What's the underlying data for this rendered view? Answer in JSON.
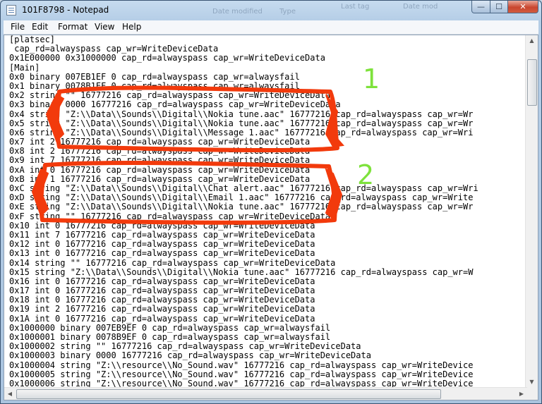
{
  "window": {
    "title": "101F8798 - Notepad"
  },
  "background_headers": [
    "Date modified",
    "Type",
    "Last tag",
    "Date mod"
  ],
  "menu": [
    "File",
    "Edit",
    "Format",
    "View",
    "Help"
  ],
  "caption_buttons": {
    "minimize": "—",
    "maximize": "☐",
    "close": "✕"
  },
  "lines": [
    "[platsec]",
    " cap_rd=alwayspass cap_wr=WriteDeviceData",
    "0x1E000000 0x31000000 cap_rd=alwayspass cap_wr=WriteDeviceData",
    "[Main]",
    "0x0 binary 007EB1EF 0 cap_rd=alwayspass cap_wr=alwaysfail",
    "0x1 binary 0078B1EF 0 cap_rd=alwayspass cap_wr=alwaysfail",
    "0x2 string \"\" 16777216 cap_rd=alwayspass cap_wr=WriteDeviceData",
    "0x3 binary 0000 16777216 cap_rd=alwayspass cap_wr=WriteDeviceData",
    "0x4 string \"Z:\\\\Data\\\\Sounds\\\\Digital\\\\Nokia tune.aac\" 16777216 cap_rd=alwayspass cap_wr=Wr",
    "0x5 string \"Z:\\\\Data\\\\Sounds\\\\Digital\\\\Nokia tune.aac\" 16777216 cap_rd=alwayspass cap_wr=Wr",
    "0x6 string \"Z:\\\\Data\\\\Sounds\\\\Digital\\\\Message 1.aac\" 16777216 cap_rd=alwayspass cap_wr=Wri",
    "0x7 int 2 16777216 cap_rd=alwayspass cap_wr=WriteDeviceData",
    "0x8 int 2 16777216 cap_rd=alwayspass cap_wr=WriteDeviceData",
    "0x9 int 7 16777216 cap_rd=alwayspass cap_wr=WriteDeviceData",
    "0xA int 0 16777216 cap_rd=alwayspass cap_wr=WriteDeviceData",
    "0xB int 1 16777216 cap_rd=alwayspass cap_wr=WriteDeviceData",
    "0xC string \"Z:\\\\Data\\\\Sounds\\\\Digital\\\\Chat alert.aac\" 16777216 cap_rd=alwayspass cap_wr=Wri",
    "0xD string \"Z:\\\\Data\\\\Sounds\\\\Digital\\\\Email 1.aac\" 16777216 cap_rd=alwayspass cap_wr=Write",
    "0xE string \"Z:\\\\Data\\\\Sounds\\\\Digital\\\\Nokia tune.aac\" 16777216 cap_rd=alwayspass cap_wr=Wr",
    "0xF string \"\" 16777216 cap_rd=alwayspass cap_wr=WriteDeviceData",
    "0x10 int 0 16777216 cap_rd=alwayspass cap_wr=WriteDeviceData",
    "0x11 int 7 16777216 cap_rd=alwayspass cap_wr=WriteDeviceData",
    "0x12 int 0 16777216 cap_rd=alwayspass cap_wr=WriteDeviceData",
    "0x13 int 0 16777216 cap_rd=alwayspass cap_wr=WriteDeviceData",
    "0x14 string \"\" 16777216 cap_rd=alwayspass cap_wr=WriteDeviceData",
    "0x15 string \"Z:\\\\Data\\\\Sounds\\\\Digital\\\\Nokia tune.aac\" 16777216 cap_rd=alwayspass cap_wr=W",
    "0x16 int 0 16777216 cap_rd=alwayspass cap_wr=WriteDeviceData",
    "0x17 int 0 16777216 cap_rd=alwayspass cap_wr=WriteDeviceData",
    "0x18 int 0 16777216 cap_rd=alwayspass cap_wr=WriteDeviceData",
    "0x19 int 2 16777216 cap_rd=alwayspass cap_wr=WriteDeviceData",
    "0x1A int 0 16777216 cap_rd=alwayspass cap_wr=WriteDeviceData",
    "0x1000000 binary 007EB9EF 0 cap_rd=alwayspass cap_wr=alwaysfail",
    "0x1000001 binary 0078B9EF 0 cap_rd=alwayspass cap_wr=alwaysfail",
    "0x1000002 string \"\" 16777216 cap_rd=alwayspass cap_wr=WriteDeviceData",
    "0x1000003 binary 0000 16777216 cap_rd=alwayspass cap_wr=WriteDeviceData",
    "0x1000004 string \"Z:\\\\resource\\\\No_Sound.wav\" 16777216 cap_rd=alwayspass cap_wr=WriteDevice",
    "0x1000005 string \"Z:\\\\resource\\\\No_Sound.wav\" 16777216 cap_rd=alwayspass cap_wr=WriteDevice",
    "0x1000006 string \"Z:\\\\resource\\\\No_Sound.wav\" 16777216 cap_rd=alwayspass cap_wr=WriteDevice"
  ],
  "annotations": {
    "label_1": "1",
    "label_2": "2",
    "highlight_color": "#f23a0c",
    "label_color": "#7ee23c"
  },
  "scroll": {
    "vertical_arrow_up": "▲",
    "vertical_arrow_down": "▼",
    "horizontal_arrow_left": "◀",
    "horizontal_arrow_right": "▶"
  }
}
